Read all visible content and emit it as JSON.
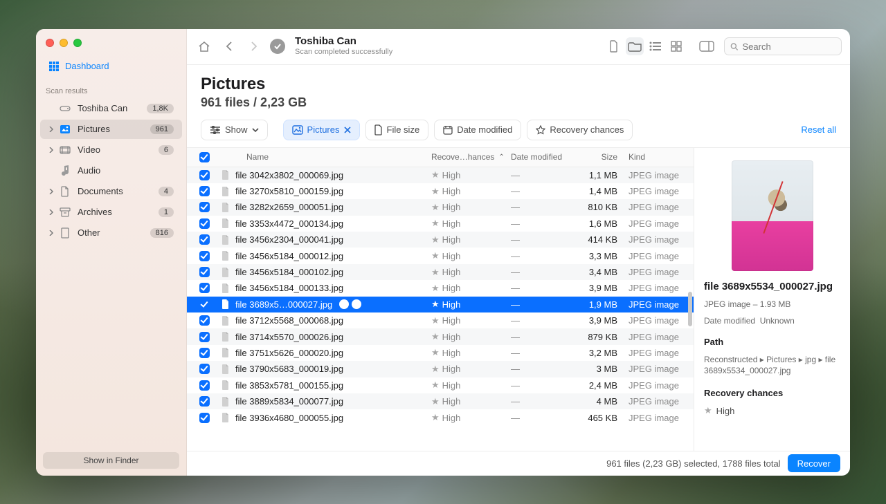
{
  "header": {
    "title": "Toshiba Can",
    "subtitle": "Scan completed successfully",
    "search_placeholder": "Search"
  },
  "sidebar": {
    "dashboard_label": "Dashboard",
    "section_label": "Scan results",
    "items": [
      {
        "label": "Toshiba Can",
        "badge": "1,8K",
        "kind": "drive"
      },
      {
        "label": "Pictures",
        "badge": "961",
        "kind": "pictures",
        "active": true
      },
      {
        "label": "Video",
        "badge": "6",
        "kind": "video"
      },
      {
        "label": "Audio",
        "badge": "",
        "kind": "audio"
      },
      {
        "label": "Documents",
        "badge": "4",
        "kind": "documents"
      },
      {
        "label": "Archives",
        "badge": "1",
        "kind": "archives"
      },
      {
        "label": "Other",
        "badge": "816",
        "kind": "other"
      }
    ],
    "footer_button": "Show in Finder"
  },
  "page": {
    "title": "Pictures",
    "summary": "961 files / 2,23 GB"
  },
  "filters": {
    "show_label": "Show",
    "active_label": "Pictures",
    "file_size_label": "File size",
    "date_modified_label": "Date modified",
    "recovery_label": "Recovery chances",
    "reset_label": "Reset all"
  },
  "columns": {
    "name": "Name",
    "recovery": "Recove…hances",
    "date": "Date modified",
    "size": "Size",
    "kind": "Kind"
  },
  "rows": [
    {
      "name": "file 3042x3802_000069.jpg",
      "recovery": "High",
      "date": "—",
      "size": "1,1 MB",
      "kind": "JPEG image"
    },
    {
      "name": "file 3270x5810_000159.jpg",
      "recovery": "High",
      "date": "—",
      "size": "1,4 MB",
      "kind": "JPEG image"
    },
    {
      "name": "file 3282x2659_000051.jpg",
      "recovery": "High",
      "date": "—",
      "size": "810 KB",
      "kind": "JPEG image"
    },
    {
      "name": "file 3353x4472_000134.jpg",
      "recovery": "High",
      "date": "—",
      "size": "1,6 MB",
      "kind": "JPEG image"
    },
    {
      "name": "file 3456x2304_000041.jpg",
      "recovery": "High",
      "date": "—",
      "size": "414 KB",
      "kind": "JPEG image"
    },
    {
      "name": "file 3456x5184_000012.jpg",
      "recovery": "High",
      "date": "—",
      "size": "3,3 MB",
      "kind": "JPEG image"
    },
    {
      "name": "file 3456x5184_000102.jpg",
      "recovery": "High",
      "date": "—",
      "size": "3,4 MB",
      "kind": "JPEG image"
    },
    {
      "name": "file 3456x5184_000133.jpg",
      "recovery": "High",
      "date": "—",
      "size": "3,9 MB",
      "kind": "JPEG image"
    },
    {
      "name": "file 3689x5…000027.jpg",
      "recovery": "High",
      "date": "—",
      "size": "1,9 MB",
      "kind": "JPEG image",
      "selected": true
    },
    {
      "name": "file 3712x5568_000068.jpg",
      "recovery": "High",
      "date": "—",
      "size": "3,9 MB",
      "kind": "JPEG image"
    },
    {
      "name": "file 3714x5570_000026.jpg",
      "recovery": "High",
      "date": "—",
      "size": "879 KB",
      "kind": "JPEG image"
    },
    {
      "name": "file 3751x5626_000020.jpg",
      "recovery": "High",
      "date": "—",
      "size": "3,2 MB",
      "kind": "JPEG image"
    },
    {
      "name": "file 3790x5683_000019.jpg",
      "recovery": "High",
      "date": "—",
      "size": "3 MB",
      "kind": "JPEG image"
    },
    {
      "name": "file 3853x5781_000155.jpg",
      "recovery": "High",
      "date": "—",
      "size": "2,4 MB",
      "kind": "JPEG image"
    },
    {
      "name": "file 3889x5834_000077.jpg",
      "recovery": "High",
      "date": "—",
      "size": "4 MB",
      "kind": "JPEG image"
    },
    {
      "name": "file 3936x4680_000055.jpg",
      "recovery": "High",
      "date": "—",
      "size": "465 KB",
      "kind": "JPEG image"
    }
  ],
  "inspector": {
    "title": "file 3689x5534_000027.jpg",
    "line1": "JPEG image – 1.93 MB",
    "date_label": "Date modified",
    "date_value": "Unknown",
    "path_label": "Path",
    "path_value": "Reconstructed ▸ Pictures ▸ jpg ▸ file 3689x5534_000027.jpg",
    "recovery_label": "Recovery chances",
    "recovery_value": "High"
  },
  "footer": {
    "status": "961 files (2,23 GB) selected, 1788 files total",
    "button": "Recover"
  }
}
